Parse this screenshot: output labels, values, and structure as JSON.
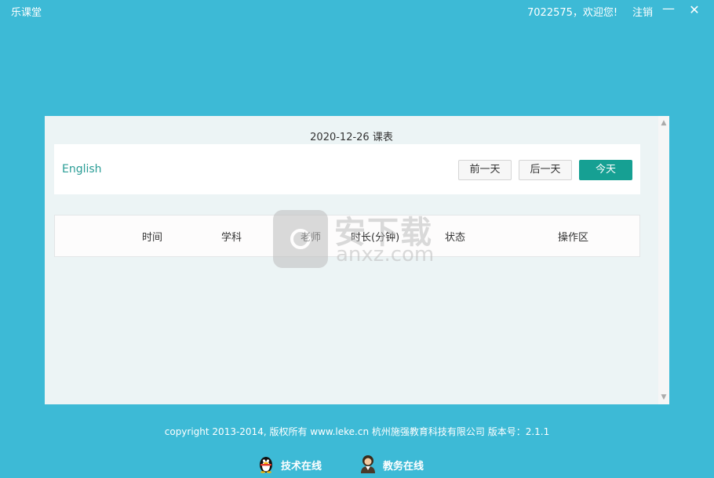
{
  "titlebar": {
    "app_title": "乐课堂",
    "welcome": "7022575，欢迎您!",
    "logout": "注销",
    "minimize_glyph": "—",
    "close_glyph": "✕"
  },
  "schedule": {
    "date_title": "2020-12-26 课表",
    "language": "English",
    "prev_day": "前一天",
    "next_day": "后一天",
    "today": "今天",
    "columns": [
      "时间",
      "学科",
      "老师",
      "时长(分钟)",
      "状态",
      "操作区"
    ]
  },
  "watermark": {
    "cn": "安下载",
    "en": "anxz.com"
  },
  "footer": {
    "copyright": "copyright 2013-2014, 版权所有 www.leke.cn 杭州施强教育科技有限公司 版本号：2.1.1",
    "tech_support": "技术在线",
    "edu_support": "教务在线"
  },
  "colors": {
    "background": "#3dbad6",
    "accent": "#16a093",
    "panel": "#ecf4f5"
  }
}
